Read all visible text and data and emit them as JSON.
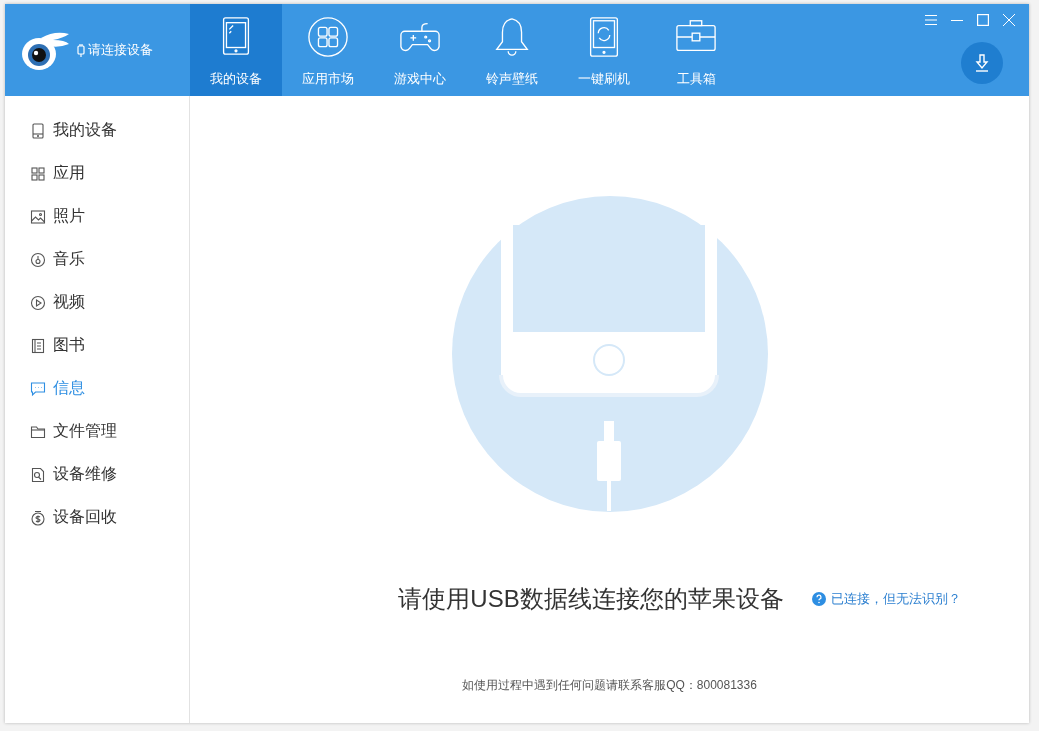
{
  "header": {
    "status": "请连接设备"
  },
  "tabs": [
    {
      "label": "我的设备",
      "selected": true
    },
    {
      "label": "应用市场",
      "selected": false
    },
    {
      "label": "游戏中心",
      "selected": false
    },
    {
      "label": "铃声壁纸",
      "selected": false
    },
    {
      "label": "一键刷机",
      "selected": false
    },
    {
      "label": "工具箱",
      "selected": false
    }
  ],
  "sidebar": {
    "items": [
      {
        "label": "我的设备",
        "selected": false
      },
      {
        "label": "应用",
        "selected": false
      },
      {
        "label": "照片",
        "selected": false
      },
      {
        "label": "音乐",
        "selected": false
      },
      {
        "label": "视频",
        "selected": false
      },
      {
        "label": "图书",
        "selected": false
      },
      {
        "label": "信息",
        "selected": true
      },
      {
        "label": "文件管理",
        "selected": false
      },
      {
        "label": "设备维修",
        "selected": false
      },
      {
        "label": "设备回收",
        "selected": false
      }
    ]
  },
  "main": {
    "message": "请使用USB数据线连接您的苹果设备",
    "help_link": "已连接，但无法识别？",
    "footer": "如使用过程中遇到任何问题请联系客服QQ：800081336"
  }
}
